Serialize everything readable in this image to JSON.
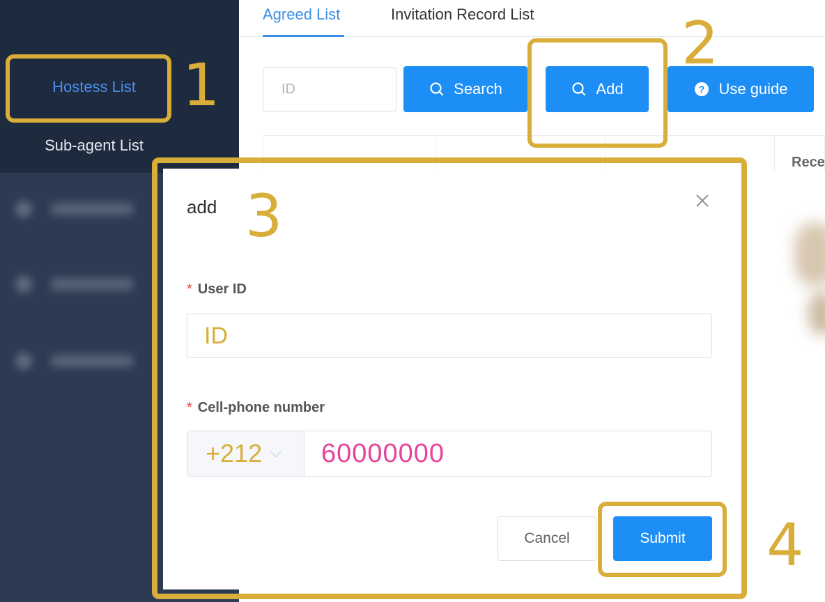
{
  "sidebar": {
    "items": [
      {
        "label": "Hostess List",
        "active": true
      },
      {
        "label": "Sub-agent List",
        "active": false
      }
    ]
  },
  "tabs": [
    {
      "label": "Agreed List",
      "active": true
    },
    {
      "label": "Invitation Record List",
      "active": false
    }
  ],
  "toolbar": {
    "id_placeholder": "ID",
    "search_label": "Search",
    "add_label": "Add",
    "guide_label": "Use guide",
    "search_icon": "search-icon",
    "add_icon": "search-icon",
    "guide_icon": "help-circle-icon"
  },
  "table": {
    "visible_header": "Rece"
  },
  "dialog": {
    "title": "add",
    "close_icon": "close-icon",
    "user_id": {
      "required_mark": "*",
      "label": "User ID",
      "value": "ID"
    },
    "phone": {
      "required_mark": "*",
      "label": "Cell-phone number",
      "country_code": "+212",
      "value": "60000000"
    },
    "cancel_label": "Cancel",
    "submit_label": "Submit"
  },
  "annotations": [
    "1",
    "2",
    "3",
    "4"
  ],
  "colors": {
    "accent": "#1e8ef7",
    "highlight": "#d9ad3a",
    "sidebar": "#2c3a52",
    "phone_value": "#e6439a"
  }
}
